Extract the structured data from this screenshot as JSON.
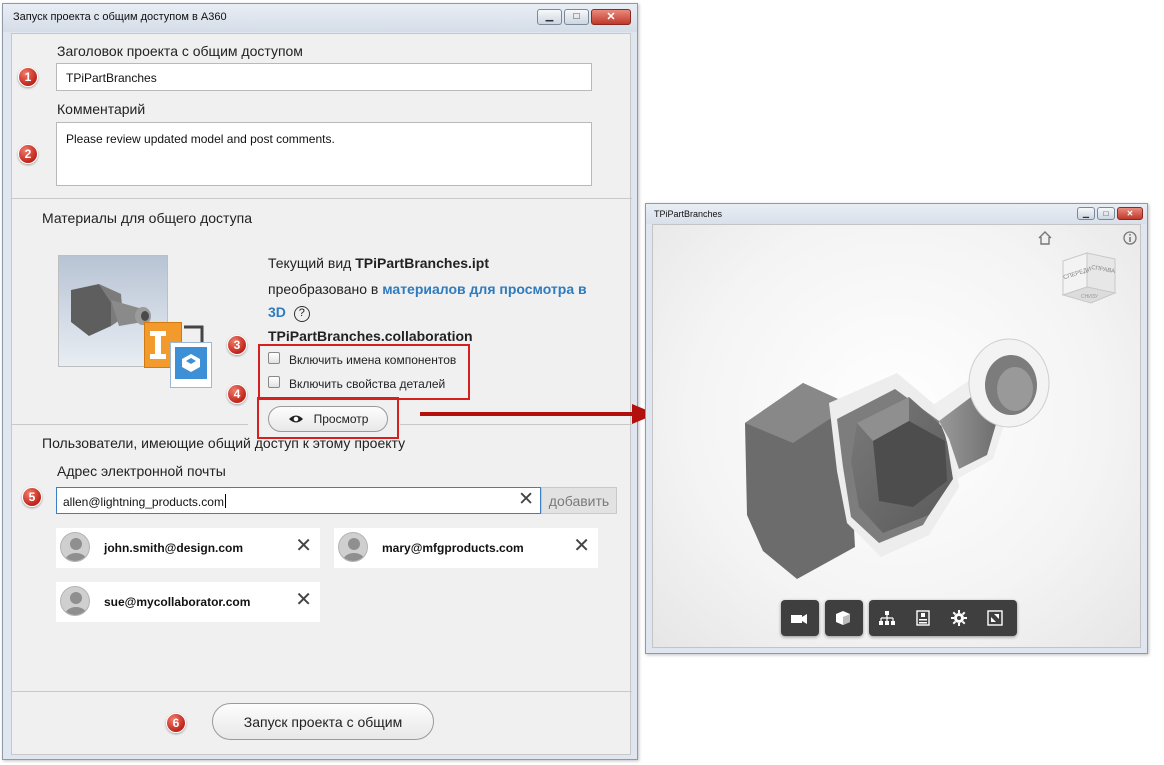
{
  "dialog": {
    "title": "Запуск проекта с общим доступом в A360",
    "project_title_label": "Заголовок проекта с общим доступом",
    "project_title_value": "TPiPartBranches",
    "comment_label": "Комментарий",
    "comment_value": "Please review updated model and post comments.",
    "materials_heading": "Материалы для общего доступа",
    "current_view_prefix": "Текущий вид ",
    "current_view_file": "TPiPartBranches.ipt",
    "converted_prefix": "преобразовано в ",
    "converted_link": "материалов для просмотра в 3D",
    "help_glyph": "?",
    "collab_file": "TPiPartBranches.collaboration",
    "checkbox_component_names": "Включить имена компонентов",
    "checkbox_part_properties": "Включить свойства деталей",
    "preview_button": "Просмотр",
    "users_heading": "Пользователи, имеющие общий доступ к этому проекту",
    "email_label": "Адрес электронной почты",
    "email_value": "allen@lightning_products.com",
    "add_button": "добавить",
    "users": [
      {
        "email": "john.smith@design.com"
      },
      {
        "email": "mary@mfgproducts.com"
      },
      {
        "email": "sue@mycollaborator.com"
      }
    ],
    "launch_button": "Запуск проекта с общим"
  },
  "badges": [
    "1",
    "2",
    "3",
    "4",
    "5",
    "6"
  ],
  "viewer": {
    "title": "TPiPartBranches",
    "viewcube_front": "СПЕРЕДИ",
    "viewcube_right": "СПРАВА",
    "viewcube_bottom": "СНИЗУ",
    "toolbar_icons": [
      "camera-icon",
      "cube-icon",
      "structure-icon",
      "properties-icon",
      "settings-icon",
      "fullscreen-icon"
    ]
  },
  "colors": {
    "annotation_red": "#d62020",
    "link_blue": "#2e7bbd",
    "model_gray": "#6d6d6d"
  }
}
